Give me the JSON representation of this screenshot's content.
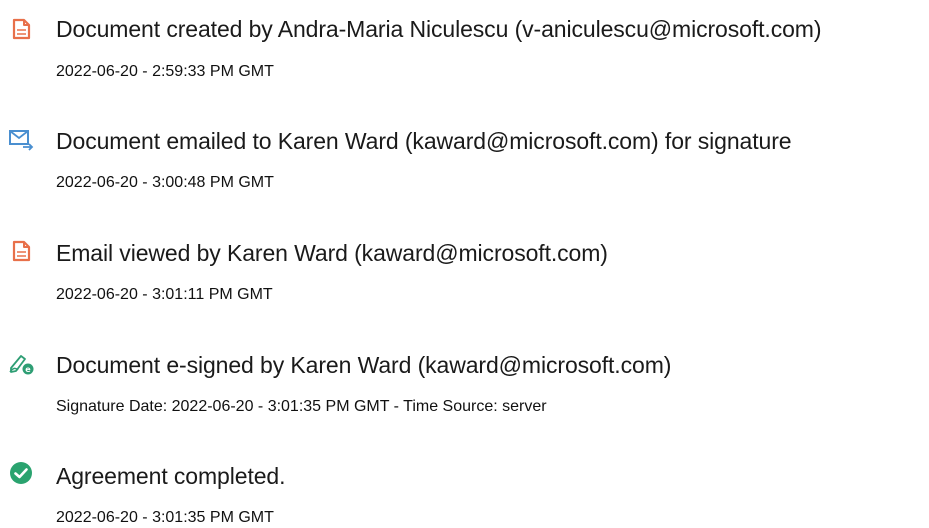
{
  "audit_log": [
    {
      "icon": "document-created-icon",
      "title": "Document created by Andra-Maria Niculescu (v-aniculescu@microsoft.com)",
      "meta": "2022-06-20 - 2:59:33 PM GMT"
    },
    {
      "icon": "email-sent-icon",
      "title": "Document emailed to Karen Ward (kaward@microsoft.com) for signature",
      "meta": "2022-06-20 - 3:00:48 PM GMT"
    },
    {
      "icon": "document-viewed-icon",
      "title": "Email viewed by Karen Ward (kaward@microsoft.com)",
      "meta": "2022-06-20 - 3:01:11 PM GMT"
    },
    {
      "icon": "e-sign-pen-icon",
      "title": "Document e-signed by Karen Ward (kaward@microsoft.com)",
      "meta": "Signature Date: 2022-06-20 - 3:01:35 PM GMT - Time Source: server"
    },
    {
      "icon": "checkmark-circle-icon",
      "title": "Agreement completed.",
      "meta": "2022-06-20 - 3:01:35 PM GMT"
    }
  ],
  "colors": {
    "document_icon": "#e8704a",
    "email_icon": "#4a8fd0",
    "sign_icon": "#2e9e74",
    "check_icon": "#2aa36f"
  }
}
